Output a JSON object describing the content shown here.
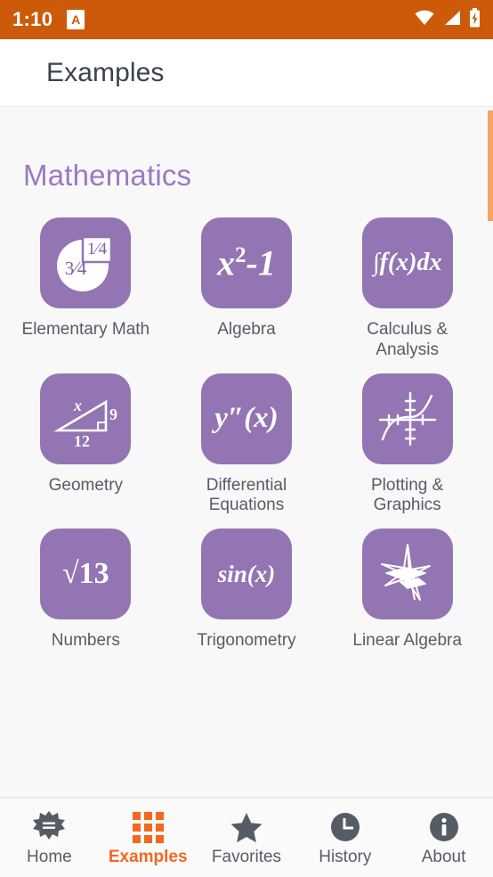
{
  "statusbar": {
    "time": "1:10",
    "notification_icon_letter": "A",
    "notification_icon_name": "app-notification-icon",
    "icons": [
      "wifi-icon",
      "cellular-signal-icon",
      "battery-charging-icon"
    ],
    "background_color": "#CC5A09"
  },
  "appbar": {
    "title": "Examples"
  },
  "scrollbar": {
    "color": "#F5A463"
  },
  "section": {
    "title": "Mathematics",
    "title_color": "#9B7AC0"
  },
  "tile_color": "#9375B3",
  "items": [
    {
      "label": "Elementary Math",
      "icon": "pie-fraction-icon",
      "glyph": "",
      "fraction_labels": [
        "1⁄4",
        "3⁄4"
      ]
    },
    {
      "label": "Algebra",
      "icon": "x-squared-minus-one-icon",
      "glyph": "x²-1"
    },
    {
      "label": "Calculus & Analysis",
      "icon": "integral-icon",
      "glyph": "∫f(x)dx"
    },
    {
      "label": "Geometry",
      "icon": "right-triangle-icon",
      "glyph": "",
      "triangle_labels": [
        "x",
        "9",
        "12"
      ]
    },
    {
      "label": "Differential Equations",
      "icon": "second-derivative-icon",
      "glyph": "y″(x)"
    },
    {
      "label": "Plotting & Graphics",
      "icon": "plot-axes-curve-icon",
      "glyph": ""
    },
    {
      "label": "Numbers",
      "icon": "square-root-icon",
      "glyph": "√13"
    },
    {
      "label": "Trigonometry",
      "icon": "sine-function-icon",
      "glyph": "sin(x)"
    },
    {
      "label": "Linear Algebra",
      "icon": "vector-plane-icon",
      "glyph": ""
    }
  ],
  "bottomnav": {
    "active_color": "#F3671F",
    "inactive_color": "#565C66",
    "tabs": [
      {
        "label": "Home",
        "icon": "wolfram-spikey-icon",
        "active": false
      },
      {
        "label": "Examples",
        "icon": "grid-icon",
        "active": true
      },
      {
        "label": "Favorites",
        "icon": "star-icon",
        "active": false
      },
      {
        "label": "History",
        "icon": "clock-icon",
        "active": false
      },
      {
        "label": "About",
        "icon": "info-icon",
        "active": false
      }
    ]
  }
}
